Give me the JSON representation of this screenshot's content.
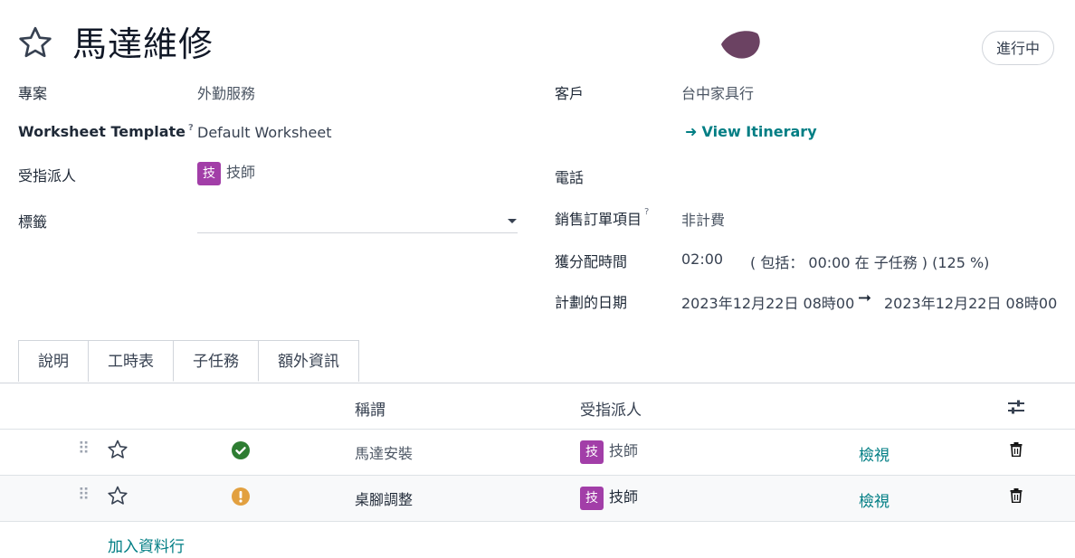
{
  "header": {
    "title": "馬達維修",
    "stage_button": "進行中",
    "colors": {
      "kanban_dot": "#6b4262",
      "avatar_bg": "#a23ea8",
      "accent": "#017e84",
      "done": "#2e7d32",
      "warning": "#e2a03f"
    }
  },
  "fields_left": {
    "project_label": "專案",
    "project_value": "外勤服務",
    "worksheet_label": "Worksheet Template",
    "worksheet_help": "?",
    "worksheet_value": "Default Worksheet",
    "assignee_label": "受指派人",
    "assignee_avatar": "技",
    "assignee_name": "技師",
    "tags_label": "標籤"
  },
  "fields_right": {
    "customer_label": "客戶",
    "customer_value": "台中家具行",
    "itinerary_link": "View Itinerary",
    "phone_label": "電話",
    "sale_item_label": "銷售訂單項目",
    "sale_item_help": "?",
    "sale_item_value": "非計費",
    "allocated_label": "獲分配時間",
    "allocated_value": "02:00",
    "allocated_detail": "( 包括： 00:00 在 子任務 ) (125 %)",
    "planned_label": "計劃的日期",
    "planned_start": "2023年12月22日 08時00",
    "planned_end": "2023年12月22日 08時00"
  },
  "tabs": [
    {
      "label": "說明"
    },
    {
      "label": "工時表"
    },
    {
      "label": "子任務"
    },
    {
      "label": "額外資訊"
    }
  ],
  "subtasks": {
    "col_title": "稱謂",
    "col_assignee": "受指派人",
    "rows": [
      {
        "title": "馬達安裝",
        "status": "done",
        "avatar": "技",
        "assignee": "技師",
        "action": "檢視"
      },
      {
        "title": "桌腳調整",
        "status": "warning",
        "avatar": "技",
        "assignee": "技師",
        "action": "檢視"
      }
    ],
    "add_line": "加入資料行"
  }
}
